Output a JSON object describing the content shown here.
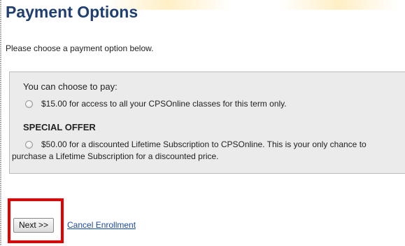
{
  "page": {
    "title": "Payment Options",
    "intro": "Please choose a payment option below."
  },
  "options": {
    "choose_text": "You can choose to pay:",
    "option1_label": "$15.00 for access to all your CPSOnline classes for this term only.",
    "special_heading": "SPECIAL OFFER",
    "option2_label": "$50.00 for a discounted Lifetime Subscription to CPSOnline. This is your only chance to purchase a Lifetime Subscription for a discounted price.",
    "option1_selected": false,
    "option2_selected": false
  },
  "actions": {
    "next_label": "Next >>",
    "cancel_label": "Cancel Enrollment"
  },
  "colors": {
    "title": "#1e3f70",
    "box_bg": "#ebebeb",
    "highlight": "#e60000",
    "link": "#1a4a9a"
  }
}
